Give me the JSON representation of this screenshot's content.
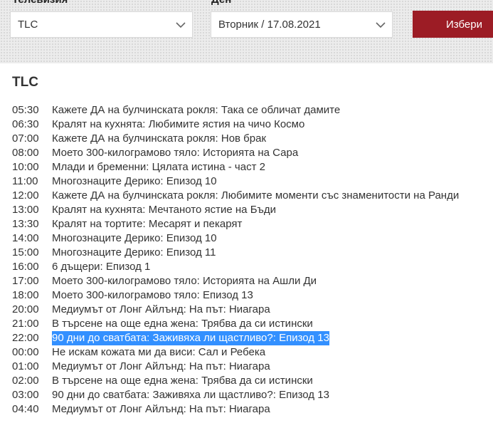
{
  "filters": {
    "channel": {
      "label": "Телевизия",
      "value": "TLC"
    },
    "day": {
      "label": "Ден",
      "value": "Вторник / 17.08.2021"
    },
    "submit_label": "Избери"
  },
  "channel_title": "TLC",
  "programmes": [
    {
      "time": "05:30",
      "title": "Кажете ДА на булчинската рокля: Така се обличат дамите"
    },
    {
      "time": "06:30",
      "title": "Кралят на кухнята: Любимите ястия на чичо Космо"
    },
    {
      "time": "07:00",
      "title": "Кажете ДА на булчинската рокля: Нов брак"
    },
    {
      "time": "08:00",
      "title": "Моето 300-килограмово тяло: Историята на Сара"
    },
    {
      "time": "10:00",
      "title": "Млади и бременни: Цялата истина - част 2"
    },
    {
      "time": "11:00",
      "title": "Многознаците Дерико: Епизод 10"
    },
    {
      "time": "12:00",
      "title": "Кажете ДА на булчинската рокля: Любимите моменти със знаменитости на Ранди"
    },
    {
      "time": "13:00",
      "title": "Кралят на кухнята: Мечтаното ястие на Бъди"
    },
    {
      "time": "13:30",
      "title": "Кралят на тортите: Месарят и пекарят"
    },
    {
      "time": "14:00",
      "title": "Многознаците Дерико: Епизод 10"
    },
    {
      "time": "15:00",
      "title": "Многознаците Дерико: Епизод 11"
    },
    {
      "time": "16:00",
      "title": "6 дъщери: Епизод 1"
    },
    {
      "time": "17:00",
      "title": "Моето 300-килограмово тяло: Историята на Ашли Ди"
    },
    {
      "time": "18:00",
      "title": "Моето 300-килограмово тяло: Епизод 13"
    },
    {
      "time": "20:00",
      "title": "Медиумът от Лонг Айлънд: На път: Ниагара"
    },
    {
      "time": "21:00",
      "title": "В търсене на още една жена: Трябва да си истински"
    },
    {
      "time": "22:00",
      "title": "90 дни до сватбата: Заживяха ли щастливо?: Епизод 13",
      "selected": true
    },
    {
      "time": "00:00",
      "title": "Не искам кожата ми да виси: Сал и Ребека"
    },
    {
      "time": "01:00",
      "title": "Медиумът от Лонг Айлънд: На път: Ниагара"
    },
    {
      "time": "02:00",
      "title": "В търсене на още една жена: Трябва да си истински"
    },
    {
      "time": "03:00",
      "title": "90 дни до сватбата: Заживяха ли щастливо?: Епизод 13"
    },
    {
      "time": "04:40",
      "title": "Медиумът от Лонг Айлънд: На път: Ниагара"
    }
  ],
  "icons": {
    "select_arrow": "chevron-down-icon"
  },
  "colors": {
    "button_bg": "#9c1c25",
    "selection_bg": "#3390ff",
    "bar_bg": "#ececec"
  }
}
